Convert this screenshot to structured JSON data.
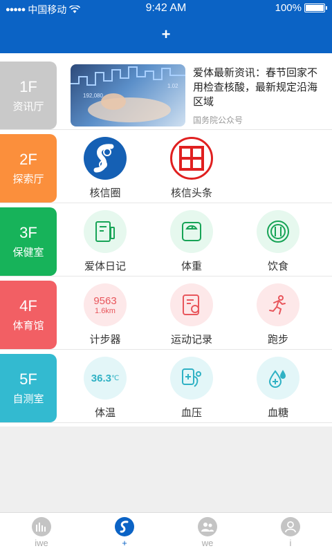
{
  "status_bar": {
    "carrier": "中国移动",
    "time": "9:42 AM",
    "battery": "100%"
  },
  "header": {
    "action": "+"
  },
  "floors": [
    {
      "num": "1F",
      "name": "资讯厅",
      "color": "#c9c9c9"
    },
    {
      "num": "2F",
      "name": "探索厅",
      "color": "#fb8f3c"
    },
    {
      "num": "3F",
      "name": "保健室",
      "color": "#17b35a"
    },
    {
      "num": "4F",
      "name": "体育馆",
      "color": "#f25f64"
    },
    {
      "num": "5F",
      "name": "自测室",
      "color": "#33bad0"
    }
  ],
  "news": {
    "title": "爱体最新资讯：春节回家不用检查核酸，最新规定沿海区域",
    "source": "国务院公众号",
    "image_text": [
      "192,080",
      "1.02"
    ]
  },
  "explore": [
    {
      "label": "核信圈"
    },
    {
      "label": "核信头条"
    }
  ],
  "health": [
    {
      "label": "爱体日记"
    },
    {
      "label": "体重"
    },
    {
      "label": "饮食"
    }
  ],
  "sports": {
    "steps_value": "9563",
    "steps_distance": "1.6km",
    "items": [
      {
        "label": "计步器"
      },
      {
        "label": "运动记录"
      },
      {
        "label": "跑步"
      }
    ]
  },
  "selftest": {
    "temperature": "36.3",
    "temperature_unit": "℃",
    "items": [
      {
        "label": "体温"
      },
      {
        "label": "血压"
      },
      {
        "label": "血糖"
      }
    ]
  },
  "tabs": [
    {
      "label": "iwe",
      "icon": "iwe-icon"
    },
    {
      "label": "+",
      "icon": "app-logo-icon"
    },
    {
      "label": "we",
      "icon": "group-icon"
    },
    {
      "label": "i",
      "icon": "user-icon"
    }
  ],
  "colors": {
    "brand": "#0b63c5",
    "green_bg": "#e6f8ee",
    "red_bg": "#fde8e9",
    "cyan_bg": "#e3f6f8"
  }
}
